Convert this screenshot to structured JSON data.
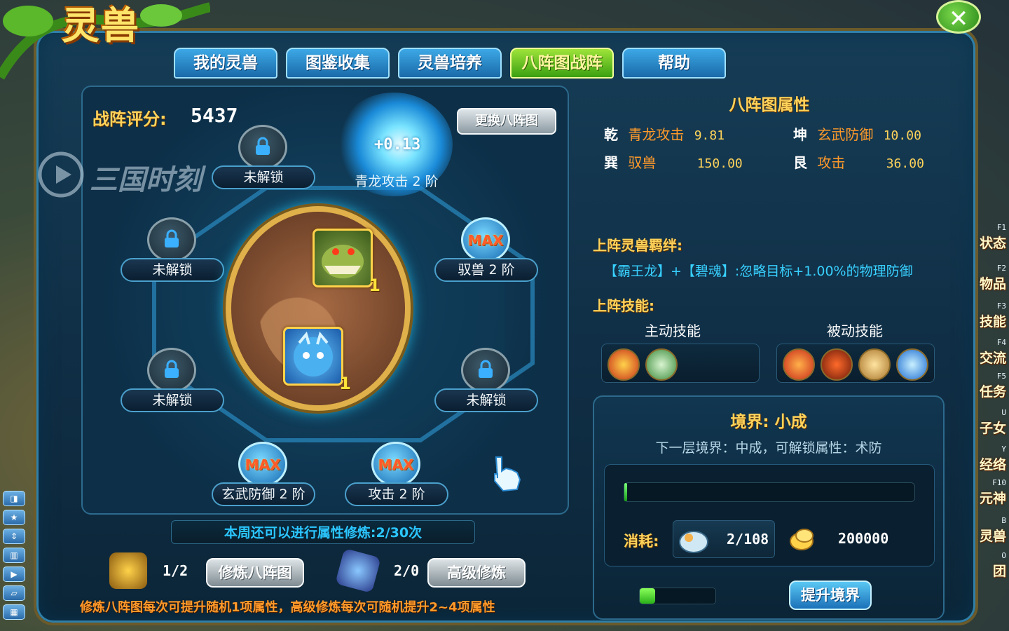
{
  "window": {
    "logo_text": "灵兽",
    "close_label": "✕"
  },
  "tabs": [
    {
      "label": "我的灵兽",
      "active": false
    },
    {
      "label": "图鉴收集",
      "active": false
    },
    {
      "label": "灵兽培养",
      "active": false
    },
    {
      "label": "八阵图战阵",
      "active": true
    },
    {
      "label": "帮助",
      "active": false
    }
  ],
  "watermark": {
    "text": "三国时刻"
  },
  "formation": {
    "score_label": "战阵评分:",
    "score_value": "5437",
    "swap_button": "更换八阵图",
    "glow": {
      "value": "+0.13",
      "label": "青龙攻击 2 阶"
    },
    "nodes": [
      {
        "label": "未解锁",
        "state": "locked"
      },
      {
        "label": "未解锁",
        "state": "locked"
      },
      {
        "label": "驭兽 2 阶",
        "state": "max",
        "badge": "MAX"
      },
      {
        "label": "未解锁",
        "state": "locked"
      },
      {
        "label": "未解锁",
        "state": "locked"
      },
      {
        "label": "玄武防御 2 阶",
        "state": "max",
        "badge": "MAX"
      },
      {
        "label": "攻击 2 阶",
        "state": "max",
        "badge": "MAX"
      }
    ],
    "pets": [
      {
        "name": "dragon-pet",
        "level": "1"
      },
      {
        "name": "blue-beast-pet",
        "level": "1"
      }
    ]
  },
  "training": {
    "week_text": "本周还可以进行属性修炼:2/30次",
    "basic": {
      "count": "1/2",
      "button": "修炼八阵图"
    },
    "advanced": {
      "count": "2/0",
      "button": "高级修炼"
    },
    "tip": "修炼八阵图每次可提升随机1项属性，高级修炼每次可随机提升2~4项属性"
  },
  "attributes": {
    "title": "八阵图属性",
    "rows": [
      {
        "trigram": "乾",
        "name": "青龙攻击",
        "value": "9.81"
      },
      {
        "trigram": "坤",
        "name": "玄武防御",
        "value": "10.00"
      },
      {
        "trigram": "巽",
        "name": "驭兽",
        "value": "150.00"
      },
      {
        "trigram": "艮",
        "name": "攻击",
        "value": "36.00"
      }
    ],
    "bond_label": "上阵灵兽羁绊:",
    "bond_text": "【霸王龙】+【碧魂】:忽略目标+1.00%的物理防御",
    "skills_label": "上阵技能:",
    "active_skills_label": "主动技能",
    "passive_skills_label": "被动技能",
    "active_skills": [
      "fire-claw-skill-icon",
      "green-shield-skill-icon"
    ],
    "passive_skills": [
      "fire-burst-skill-icon",
      "lava-skill-icon",
      "golden-shield-skill-icon",
      "water-skill-icon"
    ]
  },
  "realm": {
    "title": "境界: 小成",
    "next_text": "下一层境界：中成，可解锁属性：术防",
    "progress": 0.01,
    "cost_label": "消耗:",
    "item_count": "2/108",
    "gold_amount": "200000",
    "small_progress": 0.2,
    "upgrade_button": "提升境界"
  },
  "hud": {
    "right_menu": [
      {
        "key": "F1",
        "label": "状态"
      },
      {
        "key": "F2",
        "label": "物品"
      },
      {
        "key": "F3",
        "label": "技能"
      },
      {
        "key": "F4",
        "label": "交流"
      },
      {
        "key": "F5",
        "label": "任务"
      },
      {
        "key": "U",
        "label": "子女"
      },
      {
        "key": "Y",
        "label": "经络"
      },
      {
        "key": "F10",
        "label": "元神"
      },
      {
        "key": "B",
        "label": "灵兽"
      },
      {
        "key": "O",
        "label": "团"
      }
    ],
    "left_tools": [
      "split-icon",
      "star-icon",
      "arrows-icon",
      "chart-icon",
      "play-icon",
      "eraser-icon",
      "grid-icon"
    ]
  },
  "colors": {
    "accent_gold": "#ffd35a",
    "accent_blue": "#38d0ff",
    "active_tab": "#3aa010",
    "panel": "#0f2d44"
  }
}
